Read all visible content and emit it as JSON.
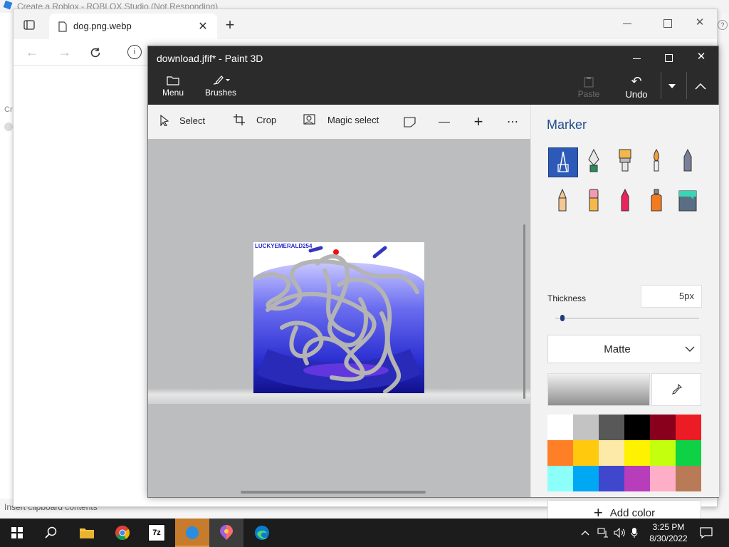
{
  "background": {
    "title_fragment": "Create a Roblox - ROBLOX Studio (Not Responding)",
    "left_fragment": "Cr",
    "status_text": "Insert clipboard contents"
  },
  "browser": {
    "tab_title": "dog.png.webp"
  },
  "paint": {
    "window_title": "download.jfif* - Paint 3D",
    "menu_label": "Menu",
    "brushes_label": "Brushes",
    "paste_label": "Paste",
    "undo_label": "Undo",
    "tools": {
      "select": "Select",
      "crop": "Crop",
      "magic_select": "Magic select"
    },
    "canvas_watermark": "LUCKYEMERALD254",
    "side": {
      "heading": "Marker",
      "thickness_label": "Thickness",
      "thickness_value": "5",
      "thickness_unit": "px",
      "thickness_slider_level": 0.05,
      "finish_value": "Matte",
      "add_color_label": "Add color",
      "palette": [
        "#ffffff",
        "#c3c3c3",
        "#585858",
        "#000000",
        "#88001b",
        "#ec1c24",
        "#ff7f27",
        "#ffc90e",
        "#fde9a8",
        "#fff200",
        "#c4ff0e",
        "#0ed145",
        "#8cfffb",
        "#00a8f3",
        "#3f48cc",
        "#b83dba",
        "#ffaec8",
        "#b97a57"
      ],
      "brush_names": [
        "marker-icon",
        "calligraphy-pen-icon",
        "oil-brush-icon",
        "watercolor-icon",
        "pixel-pen-icon",
        "pencil-icon",
        "eraser-icon",
        "crayon-icon",
        "spray-can-icon",
        "fill-bucket-icon"
      ]
    }
  },
  "taskbar": {
    "time": "3:25 PM",
    "date": "8/30/2022"
  }
}
